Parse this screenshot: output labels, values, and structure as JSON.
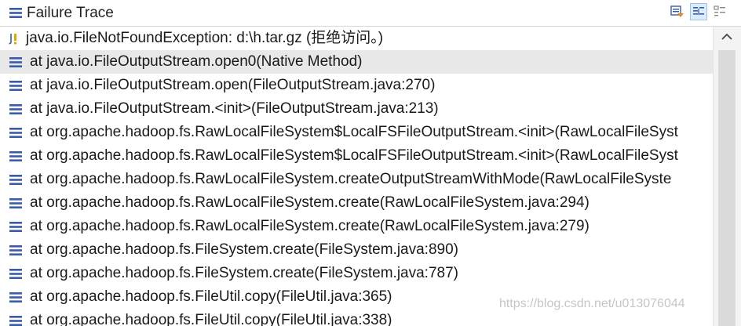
{
  "header": {
    "title": "Failure Trace",
    "icon": "stack-trace-icon",
    "toolbar": [
      {
        "name": "compare-result-button",
        "icon": "compare-icon"
      },
      {
        "name": "filter-stack-button",
        "icon": "filter-trace-icon",
        "active": true
      },
      {
        "name": "more-options-button",
        "icon": "options-icon"
      }
    ]
  },
  "trace": {
    "exception": "java.io.FileNotFoundException: d:\\h.tar.gz (拒绝访问。)",
    "frames": [
      "at java.io.FileOutputStream.open0(Native Method)",
      "at java.io.FileOutputStream.open(FileOutputStream.java:270)",
      "at java.io.FileOutputStream.<init>(FileOutputStream.java:213)",
      "at org.apache.hadoop.fs.RawLocalFileSystem$LocalFSFileOutputStream.<init>(RawLocalFileSyst",
      "at org.apache.hadoop.fs.RawLocalFileSystem$LocalFSFileOutputStream.<init>(RawLocalFileSyst",
      "at org.apache.hadoop.fs.RawLocalFileSystem.createOutputStreamWithMode(RawLocalFileSyste",
      "at org.apache.hadoop.fs.RawLocalFileSystem.create(RawLocalFileSystem.java:294)",
      "at org.apache.hadoop.fs.RawLocalFileSystem.create(RawLocalFileSystem.java:279)",
      "at org.apache.hadoop.fs.FileSystem.create(FileSystem.java:890)",
      "at org.apache.hadoop.fs.FileSystem.create(FileSystem.java:787)",
      "at org.apache.hadoop.fs.FileUtil.copy(FileUtil.java:365)",
      "at org.apache.hadoop.fs.FileUtil.copy(FileUtil.java:338)"
    ],
    "selected_index": 0
  },
  "watermark": "https://blog.csdn.net/u013076044",
  "colors": {
    "frame_icon": "#3a5ba8",
    "exception_icon": "#e0a600",
    "selected_bg": "#e8e8e8"
  }
}
